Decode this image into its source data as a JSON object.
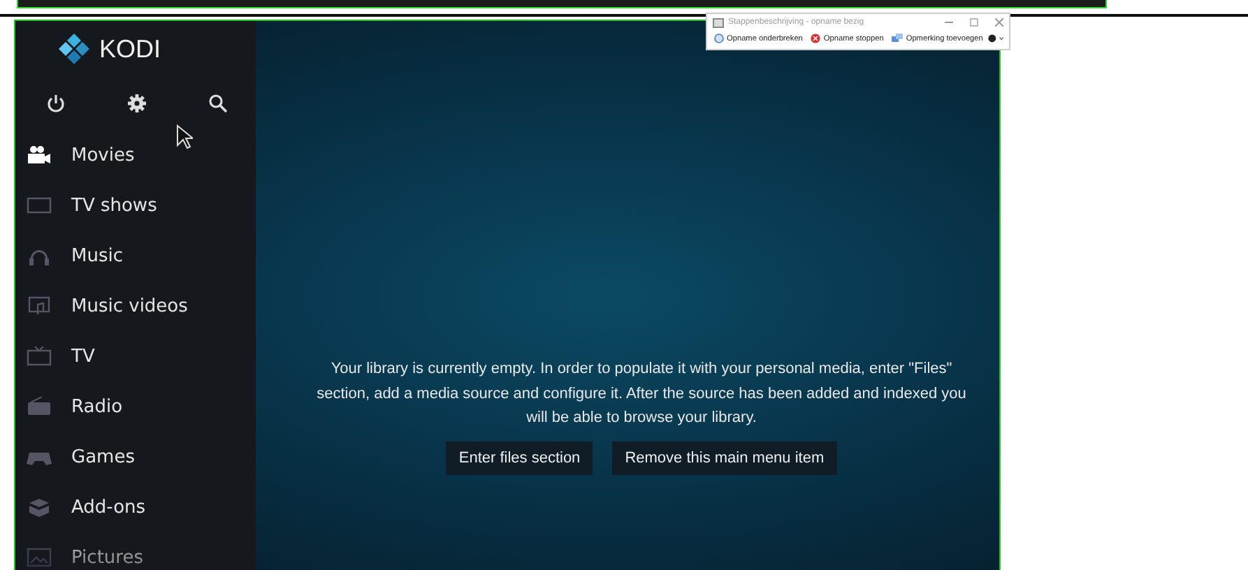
{
  "app": {
    "logo": "KODI"
  },
  "sidebar": {
    "items": [
      {
        "label": "Movies",
        "kind": "movies",
        "selected": true
      },
      {
        "label": "TV shows",
        "kind": "tv",
        "selected": false
      },
      {
        "label": "Music",
        "kind": "headphones",
        "selected": false
      },
      {
        "label": "Music videos",
        "kind": "musicvideo",
        "selected": false
      },
      {
        "label": "TV",
        "kind": "tvset",
        "selected": false
      },
      {
        "label": "Radio",
        "kind": "radio",
        "selected": false
      },
      {
        "label": "Games",
        "kind": "gamepad",
        "selected": false
      },
      {
        "label": "Add-ons",
        "kind": "box",
        "selected": false
      },
      {
        "label": "Pictures",
        "kind": "picture",
        "selected": false
      }
    ]
  },
  "main": {
    "message": "Your library is currently empty. In order to populate it with your personal media, enter \"Files\" section, add a media source and configure it. After the source has been added and indexed you will be able to browse your library.",
    "buttons": [
      "Enter files section",
      "Remove this main menu item"
    ]
  },
  "recorder": {
    "title": "Stappenbeschrijving - opname bezig",
    "buttons": [
      {
        "label": "Opname onderbreken",
        "kind": "pause"
      },
      {
        "label": "Opname stoppen",
        "kind": "stop"
      },
      {
        "label": "Opmerking toevoegen",
        "kind": "comment"
      }
    ]
  }
}
